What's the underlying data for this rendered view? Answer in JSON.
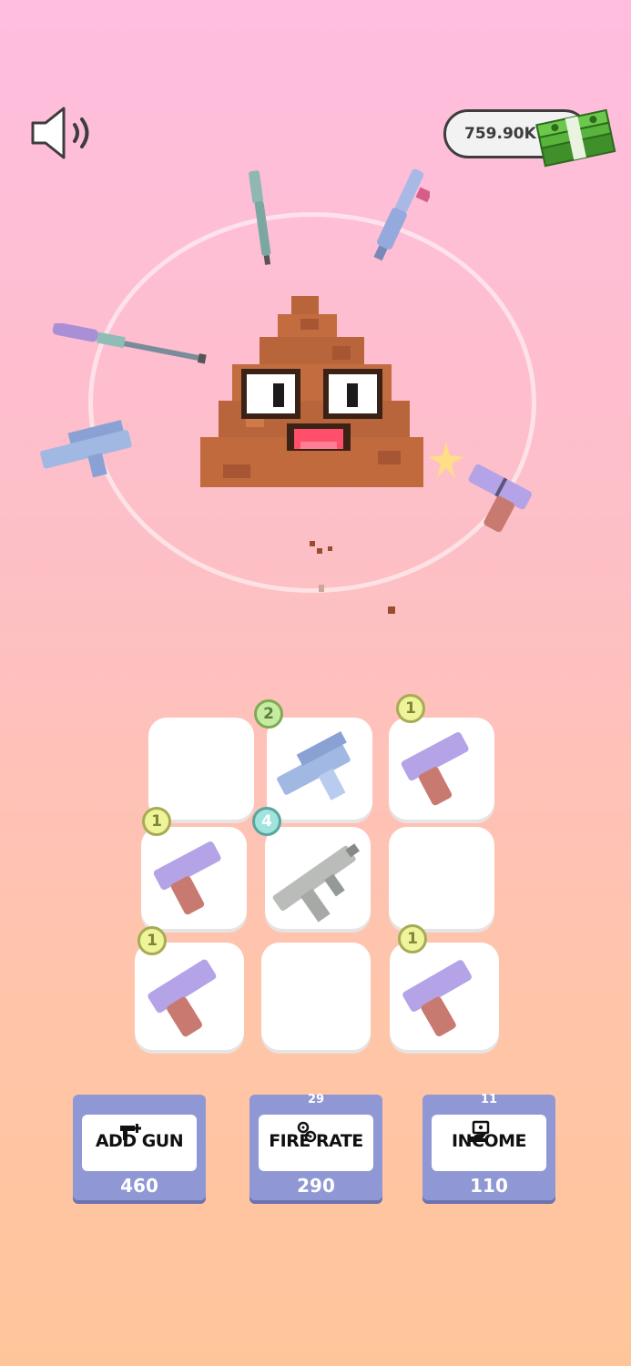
{
  "hud": {
    "money": "759.90K",
    "sound_icon": "speaker-icon",
    "cash_icon": "cash-stack-icon"
  },
  "colors": {
    "upgrade_bg": "#8f98d4",
    "badge_level1": "#eef49a",
    "badge_level2": "#c6eca1",
    "badge_level4": "#9fe4dd",
    "enemy_brown": "#b8653b"
  },
  "arena": {
    "enemy": "poop-emoji-enemy",
    "orbiting_weapons": [
      "rifle",
      "smg",
      "shotgun",
      "uzi",
      "pistol"
    ]
  },
  "grid": {
    "slots": [
      {
        "weapon": null,
        "level": ""
      },
      {
        "weapon": "uzi",
        "level": "2"
      },
      {
        "weapon": "pistol",
        "level": "1"
      },
      {
        "weapon": "pistol",
        "level": "1"
      },
      {
        "weapon": "smg",
        "level": "4"
      },
      {
        "weapon": null,
        "level": ""
      },
      {
        "weapon": "pistol",
        "level": "1"
      },
      {
        "weapon": null,
        "level": ""
      },
      {
        "weapon": "pistol",
        "level": "1"
      }
    ]
  },
  "upgrades": [
    {
      "label": "ADD GUN",
      "cost": "460",
      "level": "",
      "icon": "add-gun-icon"
    },
    {
      "label": "FIRE RATE",
      "cost": "290",
      "level": "29",
      "icon": "gears-icon"
    },
    {
      "label": "INCOME",
      "cost": "110",
      "level": "11",
      "icon": "money-hand-icon"
    }
  ]
}
